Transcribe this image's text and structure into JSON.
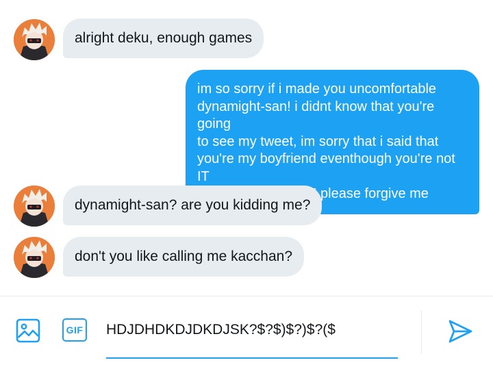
{
  "messages": [
    {
      "direction": "incoming",
      "text": "alright deku, enough games"
    },
    {
      "direction": "outgoing",
      "lines": [
        "im so sorry if i made you uncomfortable",
        "dynamight-san! i didnt know that you're going",
        "to see my tweet, im sorry that i said that",
        "you're my boyfriend eventhough you're not IT",
        "WAS JUST A JOKE please forgive me"
      ]
    },
    {
      "direction": "incoming",
      "text": "dynamight-san? are you kidding me?"
    },
    {
      "direction": "incoming",
      "text": "don't you like calling me kacchan?"
    }
  ],
  "composer": {
    "gif_label": "GIF",
    "input_value": "HDJDHDKDJDKDJSK?$?$)$?)$?($"
  },
  "colors": {
    "accent": "#1da1f2",
    "incoming_bubble": "#e6ecf0",
    "avatar_bg": "#e97f3a"
  },
  "icons": {
    "media": "image-icon",
    "send": "send-icon"
  }
}
